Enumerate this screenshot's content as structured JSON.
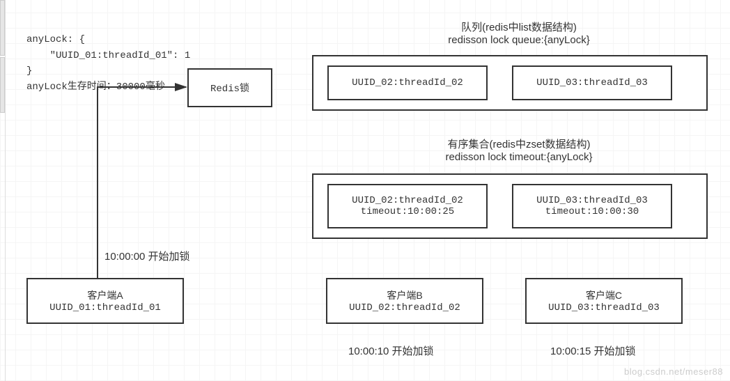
{
  "code": {
    "line1": "anyLock: {",
    "line2": "    \"UUID_01:threadId_01\": 1",
    "line3": "}",
    "line4": "anyLock生存时间：30000毫秒"
  },
  "redisLock": {
    "label": "Redis锁"
  },
  "queue": {
    "title1": "队列(redis中list数据结构)",
    "title2": "redisson lock queue:{anyLock}",
    "items": {
      "i0": "UUID_02:threadId_02",
      "i1": "UUID_03:threadId_03"
    }
  },
  "zset": {
    "title1": "有序集合(redis中zset数据结构)",
    "title2": "redisson lock timeout:{anyLock}",
    "items": {
      "i0": {
        "id": "UUID_02:threadId_02",
        "timeout": "timeout:10:00:25"
      },
      "i1": {
        "id": "UUID_03:threadId_03",
        "timeout": "timeout:10:00:30"
      }
    }
  },
  "clients": {
    "a": {
      "title": "客户端A",
      "id": "UUID_01:threadId_01",
      "time": "10:00:00 开始加锁"
    },
    "b": {
      "title": "客户端B",
      "id": "UUID_02:threadId_02",
      "time": "10:00:10 开始加锁"
    },
    "c": {
      "title": "客户端C",
      "id": "UUID_03:threadId_03",
      "time": "10:00:15 开始加锁"
    }
  },
  "watermark": "blog.csdn.net/meser88"
}
